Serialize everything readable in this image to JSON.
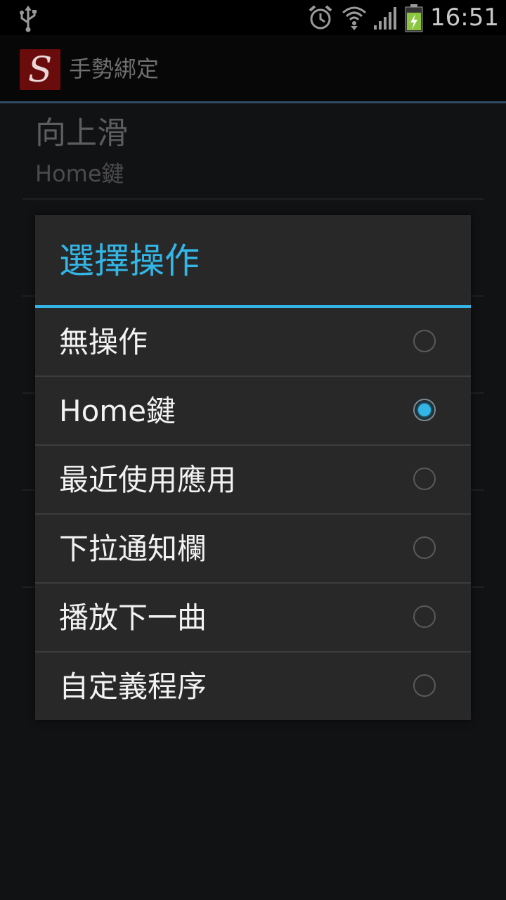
{
  "status_bar": {
    "time": "16:51",
    "icons": [
      "usb-icon",
      "alarm-icon",
      "wifi-icon",
      "signal-icon",
      "battery-charging-icon"
    ]
  },
  "action_bar": {
    "app_icon_letter": "S",
    "title": "手勢綁定"
  },
  "background_list": {
    "items": [
      {
        "title": "向上滑",
        "summary": "Home鍵"
      }
    ]
  },
  "dialog": {
    "title": "選擇操作",
    "accent_color": "#33b5e5",
    "options": [
      {
        "label": "無操作",
        "selected": false
      },
      {
        "label": "Home鍵",
        "selected": true
      },
      {
        "label": "最近使用應用",
        "selected": false
      },
      {
        "label": "下拉通知欄",
        "selected": false
      },
      {
        "label": "播放下一曲",
        "selected": false
      },
      {
        "label": "自定義程序",
        "selected": false
      }
    ]
  }
}
